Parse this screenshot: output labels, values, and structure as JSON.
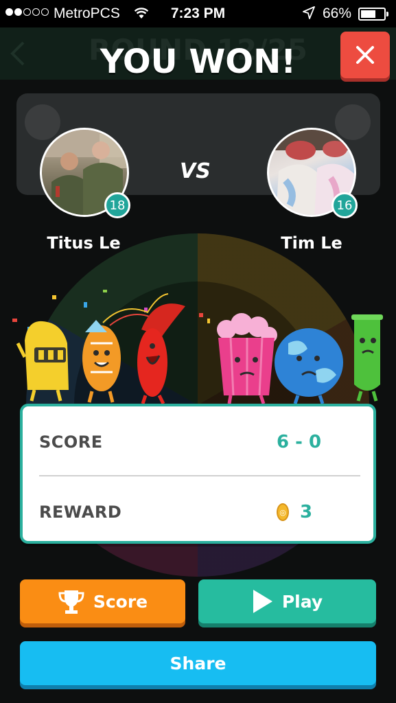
{
  "status_bar": {
    "carrier": "MetroPCS",
    "time": "7:23 PM",
    "battery": "66%",
    "battery_level": 0.66,
    "signal_bars": 2
  },
  "background": {
    "round_label": "ROUND 12/25"
  },
  "header": {
    "title": "YOU WON!",
    "close_icon": "close-icon"
  },
  "players": {
    "left": {
      "name": "Titus Le",
      "level": "18"
    },
    "right": {
      "name": "Tim Le",
      "level": "16"
    },
    "vs_label": "VS"
  },
  "results": {
    "score_label": "SCORE",
    "score_value": "6 - 0",
    "reward_label": "REWARD",
    "reward_value": "3",
    "reward_icon": "coin-icon"
  },
  "buttons": {
    "score_label": "Score",
    "play_label": "Play",
    "share_label": "Share"
  },
  "colors": {
    "accent_teal": "#2bb09e",
    "close_red": "#ed4c40",
    "score_orange": "#fa8d14",
    "play_green": "#26bc9f",
    "share_blue": "#17bdf2"
  }
}
